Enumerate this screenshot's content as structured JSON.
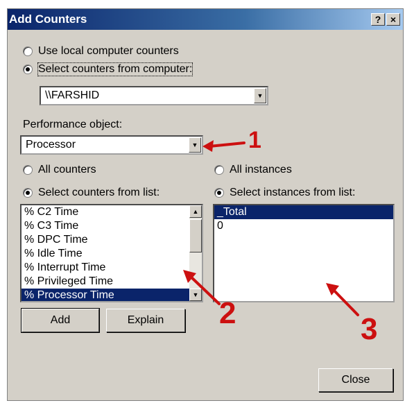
{
  "dialog": {
    "title": "Add Counters",
    "help_button": "?",
    "close_button": "×"
  },
  "source": {
    "local_option": "Use local computer counters",
    "computer_option": "Select counters from computer:",
    "selected": "computer",
    "computer_value": "\\\\FARSHID"
  },
  "performance_object": {
    "label": "Performance object:",
    "value": "Processor"
  },
  "counters": {
    "all_option": "All counters",
    "select_option": "Select counters from list:",
    "selected": "select",
    "items": [
      "% C2 Time",
      "% C3 Time",
      "% DPC Time",
      "% Idle Time",
      "% Interrupt Time",
      "% Privileged Time",
      "% Processor Time"
    ],
    "selected_item": "% Processor Time"
  },
  "instances": {
    "all_option": "All instances",
    "select_option": "Select instances from list:",
    "selected": "select",
    "items": [
      "_Total",
      "0"
    ],
    "selected_item": "_Total"
  },
  "buttons": {
    "add": "Add",
    "explain": "Explain",
    "close": "Close"
  },
  "annotations": {
    "one": "1",
    "two": "2",
    "three": "3",
    "color": "#cc1010"
  }
}
